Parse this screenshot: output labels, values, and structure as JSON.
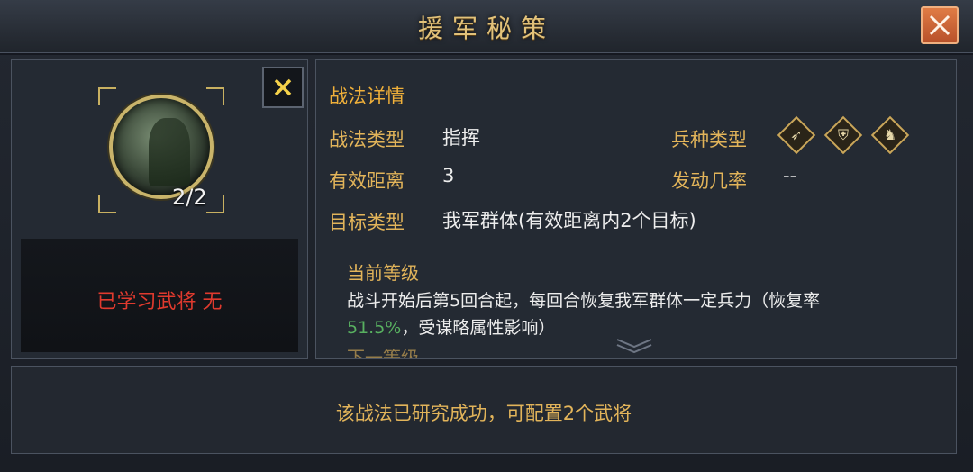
{
  "window": {
    "title": "援军秘策"
  },
  "left": {
    "count": "2/2",
    "learned_text": "已学习武将 无"
  },
  "detail": {
    "section_title": "战法详情",
    "tactic_type_label": "战法类型",
    "tactic_type_value": "指挥",
    "unit_type_label": "兵种类型",
    "unit_icons": [
      "bow-icon",
      "shield-icon",
      "horse-icon"
    ],
    "range_label": "有效距离",
    "range_value": "3",
    "trigger_label": "发动几率",
    "trigger_value": "--",
    "target_label": "目标类型",
    "target_value": "我军群体(有效距离内2个目标)",
    "current_level_label": "当前等级",
    "desc_part1": "战斗开始后第5回合起，每回合恢复我军群体一定兵力（恢复率",
    "desc_num": "51.5%",
    "desc_part2": "，受谋略属性影响）",
    "next_level_label": "下一等级"
  },
  "footer": {
    "status_text": "该战法已研究成功，可配置2个武将"
  },
  "colors": {
    "accent_gold": "#e2b45a",
    "warning_red": "#e03a2e",
    "highlight_green": "#58b060",
    "close_orange": "#d86a38"
  }
}
